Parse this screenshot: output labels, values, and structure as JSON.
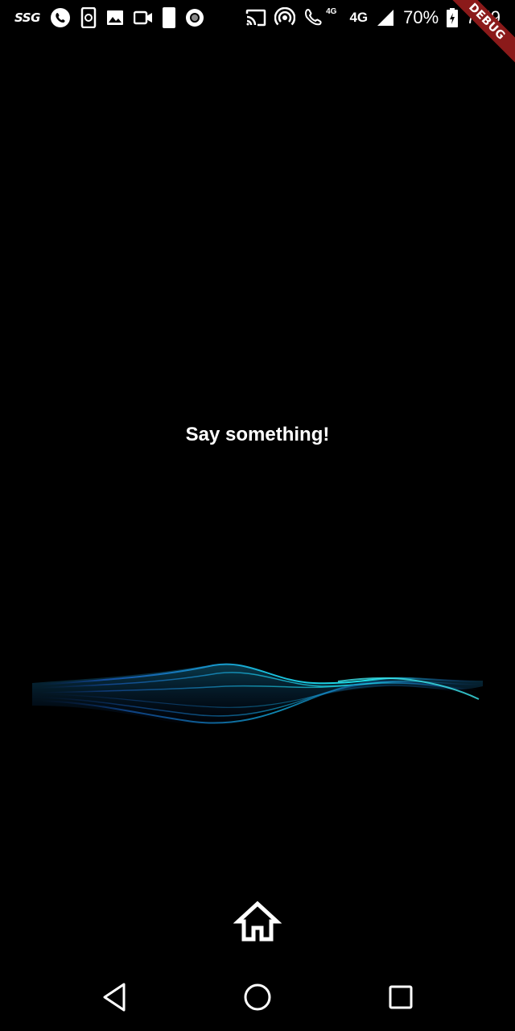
{
  "status_bar": {
    "carrier_tag": "SSG",
    "small_network_label": "4G",
    "network_label": "4G",
    "battery_percent": "70%",
    "time": "7:59",
    "icons_left": [
      "ssg-logo-icon",
      "whatsapp-icon",
      "phone-sync-icon",
      "image-icon",
      "video-call-icon",
      "phone-moon-icon",
      "record-icon"
    ],
    "icons_right": [
      "cast-icon",
      "hotspot-icon",
      "volte-call-icon",
      "signal-icon",
      "battery-charging-icon"
    ]
  },
  "debug_banner": "DEBUG",
  "main": {
    "prompt_text": "Say something!"
  },
  "colors": {
    "background": "#000000",
    "text": "#ffffff",
    "wave_primary": "#19c6e0",
    "wave_secondary": "#1a6fd0",
    "debug_ribbon": "#8b1a1a"
  },
  "bottom": {
    "home_icon": "home-outline-icon"
  },
  "nav_bar": {
    "back_icon": "back-triangle-icon",
    "home_icon": "home-circle-icon",
    "recents_icon": "recents-square-icon"
  }
}
